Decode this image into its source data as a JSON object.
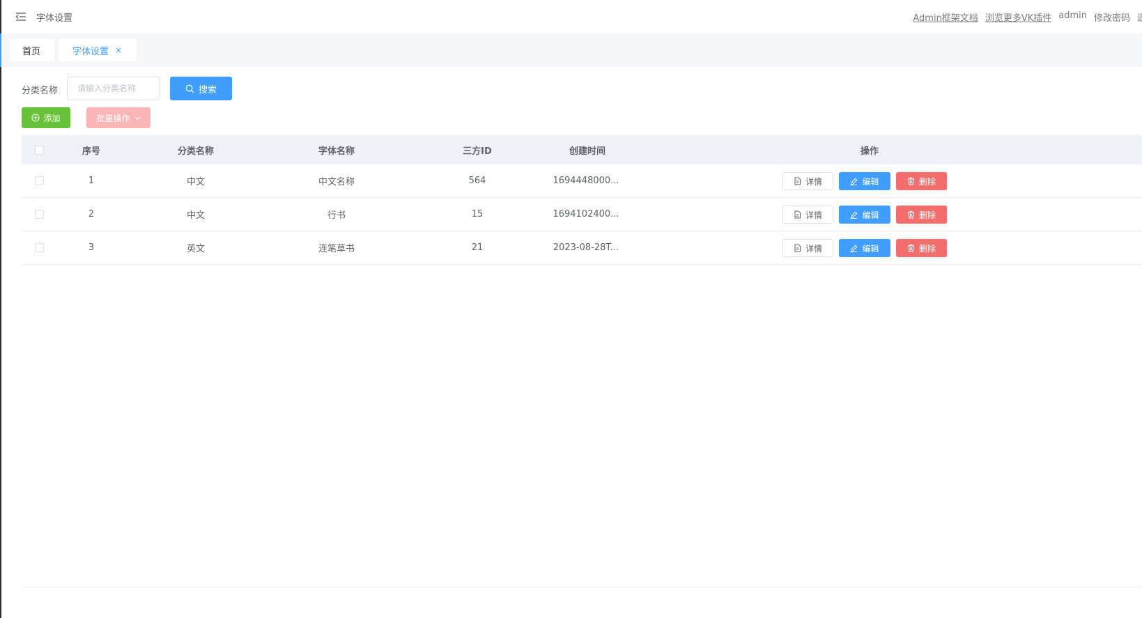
{
  "header": {
    "title": "字体设置",
    "links": [
      "Admin框架文档",
      "浏览更多VK插件"
    ],
    "user": "admin",
    "change_password": "修改密码",
    "logout": "退"
  },
  "tabs": [
    {
      "label": "首页",
      "active": false
    },
    {
      "label": "字体设置",
      "active": true,
      "close": "×"
    }
  ],
  "search": {
    "label": "分类名称",
    "placeholder": "请输入分类名称",
    "button": "搜索"
  },
  "toolbar": {
    "add_label": "添加",
    "batch_label": "批量操作"
  },
  "table": {
    "columns": [
      "序号",
      "分类名称",
      "字体名称",
      "三方ID",
      "创建时间",
      "操作"
    ],
    "rows": [
      {
        "idx": "1",
        "category": "中文",
        "font": "中文名称",
        "third_id": "564",
        "created": "1694448000..."
      },
      {
        "idx": "2",
        "category": "中文",
        "font": "行书",
        "third_id": "15",
        "created": "1694102400..."
      },
      {
        "idx": "3",
        "category": "英文",
        "font": "连笔草书",
        "third_id": "21",
        "created": "2023-08-28T..."
      }
    ],
    "actions": {
      "detail": "详情",
      "edit": "编辑",
      "delete": "删除"
    }
  },
  "colors": {
    "primary": "#409eff",
    "success": "#67c23a",
    "danger": "#f56c6c",
    "danger_light": "#fab6b6"
  },
  "icons": [
    "menu-fold-icon",
    "search-icon",
    "plus-circle-icon",
    "chevron-down-icon",
    "document-icon",
    "edit-icon",
    "trash-icon"
  ]
}
